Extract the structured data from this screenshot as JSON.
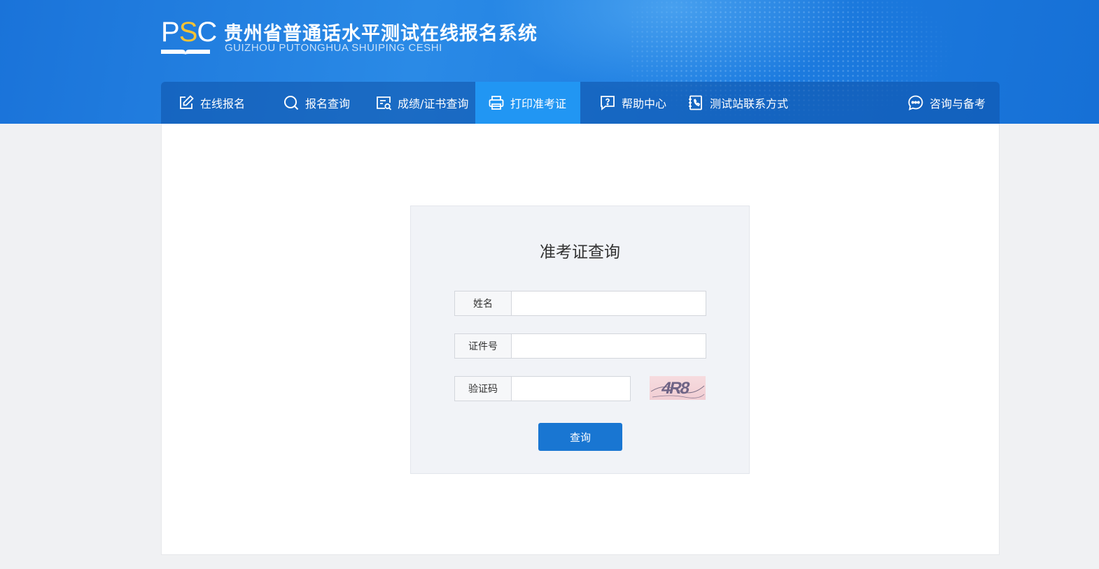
{
  "header": {
    "logo_text_p": "P",
    "logo_text_s": "S",
    "logo_text_c": "C",
    "title": "贵州省普通话水平测试在线报名系统",
    "subtitle": "GUIZHOU PUTONGHUA SHUIPING CESHI"
  },
  "nav": {
    "items": [
      {
        "label": "在线报名",
        "icon": "edit-icon"
      },
      {
        "label": "报名查询",
        "icon": "search-icon"
      },
      {
        "label": "成绩/证书查询",
        "icon": "certificate-search-icon"
      },
      {
        "label": "打印准考证",
        "icon": "printer-icon",
        "active": true
      },
      {
        "label": "帮助中心",
        "icon": "help-icon"
      },
      {
        "label": "测试站联系方式",
        "icon": "phone-book-icon"
      },
      {
        "label": "咨询与备考",
        "icon": "chat-icon"
      }
    ]
  },
  "form": {
    "title": "准考证查询",
    "name_label": "姓名",
    "name_value": "",
    "id_label": "证件号",
    "id_value": "",
    "captcha_label": "验证码",
    "captcha_value": "",
    "captcha_text": "4R8",
    "submit_label": "查询"
  },
  "colors": {
    "header_blue": "#1f7fe2",
    "nav_active": "#2196f3",
    "button_blue": "#1976d2",
    "logo_accent": "#f7c334"
  }
}
